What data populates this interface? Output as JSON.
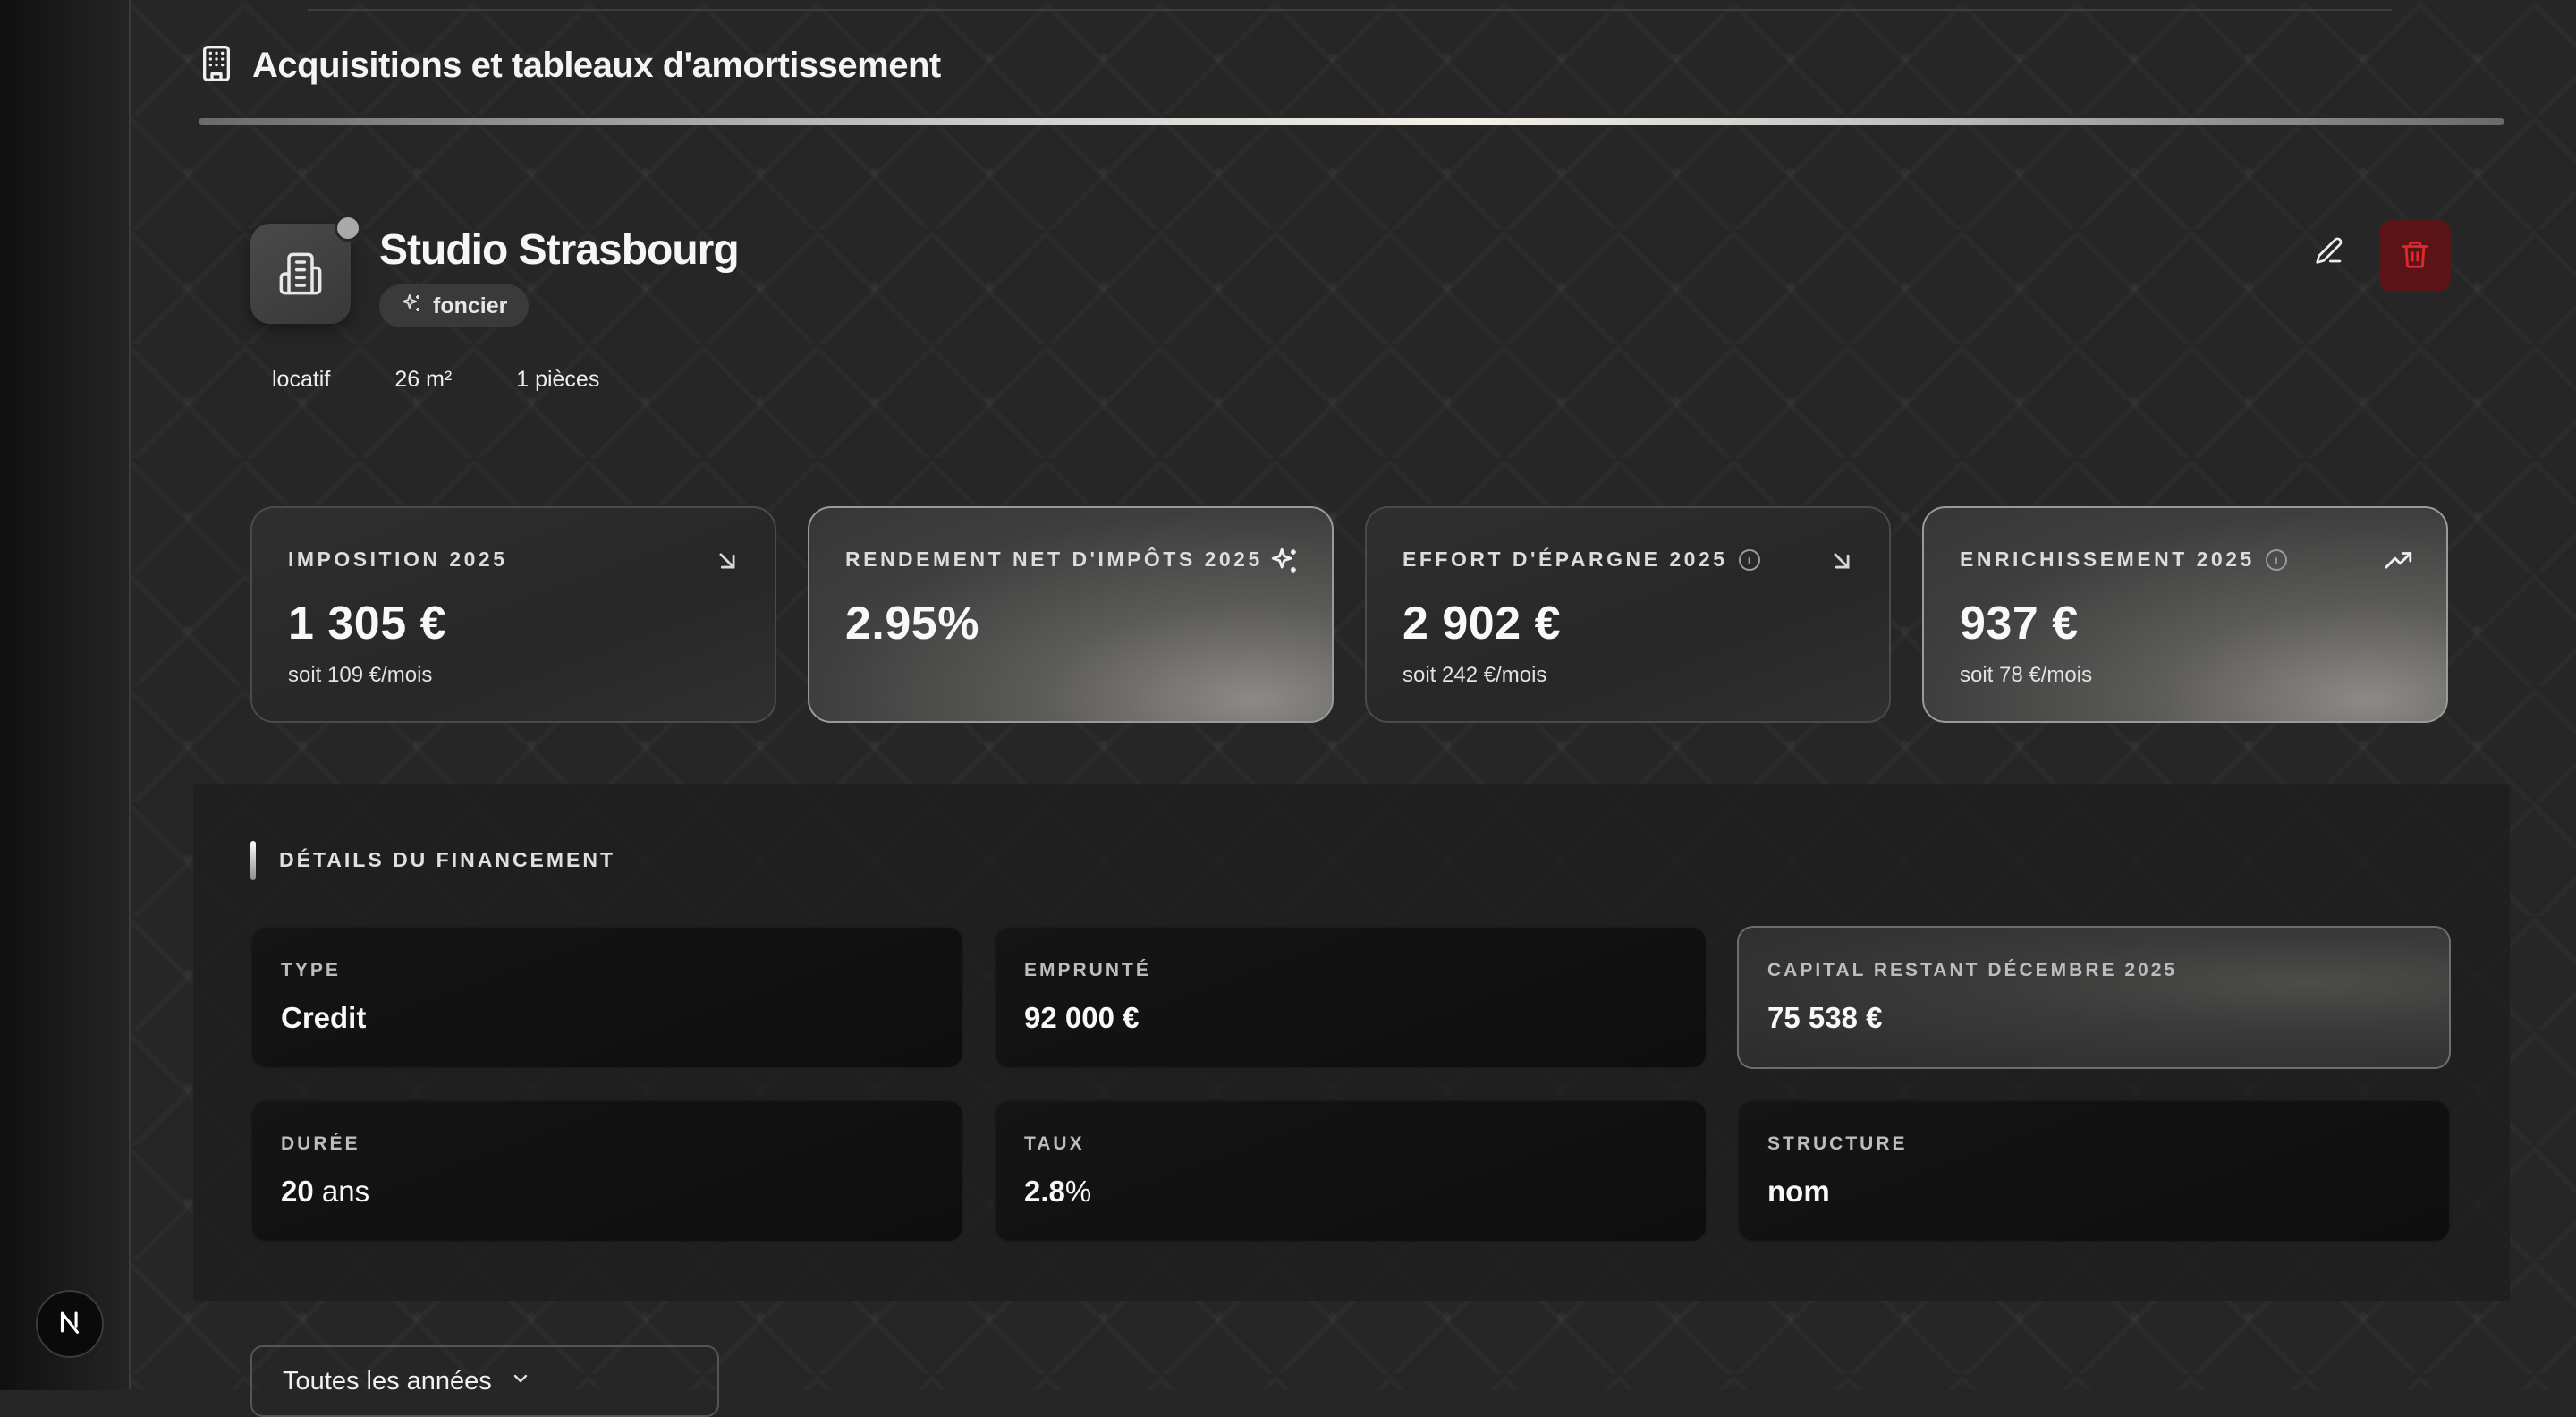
{
  "section": {
    "title": "Acquisitions et tableaux d'amortissement",
    "icon": "building-icon"
  },
  "property": {
    "name": "Studio Strasbourg",
    "tag": "foncier",
    "meta": [
      "locatif",
      "26 m²",
      "1 pièces"
    ],
    "status_color": "#a9a9a9"
  },
  "kpis": [
    {
      "label": "IMPOSITION 2025",
      "value": "1 305 €",
      "sub": "soit 109 €/mois",
      "icon": "arrow-down-right-icon",
      "info": false
    },
    {
      "label": "RENDEMENT NET D'IMPÔTS 2025",
      "value": "2.95%",
      "sub": "",
      "icon": "sparkles-icon",
      "info": false
    },
    {
      "label": "EFFORT D'ÉPARGNE 2025",
      "value": "2 902 €",
      "sub": "soit 242 €/mois",
      "icon": "arrow-down-right-icon",
      "info": true
    },
    {
      "label": "ENRICHISSEMENT 2025",
      "value": "937 €",
      "sub": "soit 78 €/mois",
      "icon": "trending-up-icon",
      "info": true
    }
  ],
  "financing": {
    "title": "DÉTAILS DU FINANCEMENT",
    "items": [
      {
        "label": "TYPE",
        "value": "Credit",
        "unit": ""
      },
      {
        "label": "EMPRUNTÉ",
        "value": "92 000 €",
        "unit": ""
      },
      {
        "label": "CAPITAL RESTANT DÉCEMBRE 2025",
        "value": "75 538 €",
        "unit": ""
      },
      {
        "label": "DURÉE",
        "value": "20",
        "unit": " ans"
      },
      {
        "label": "TAUX",
        "value": "2.8",
        "unit": "%"
      },
      {
        "label": "STRUCTURE",
        "value": "nom",
        "unit": ""
      }
    ]
  },
  "year_filter": {
    "selected": "Toutes les années"
  },
  "badge": {
    "letter": "N"
  },
  "colors": {
    "background": "#262626",
    "danger": "#d12a2a",
    "accent_bar": "#f4f1e8"
  }
}
